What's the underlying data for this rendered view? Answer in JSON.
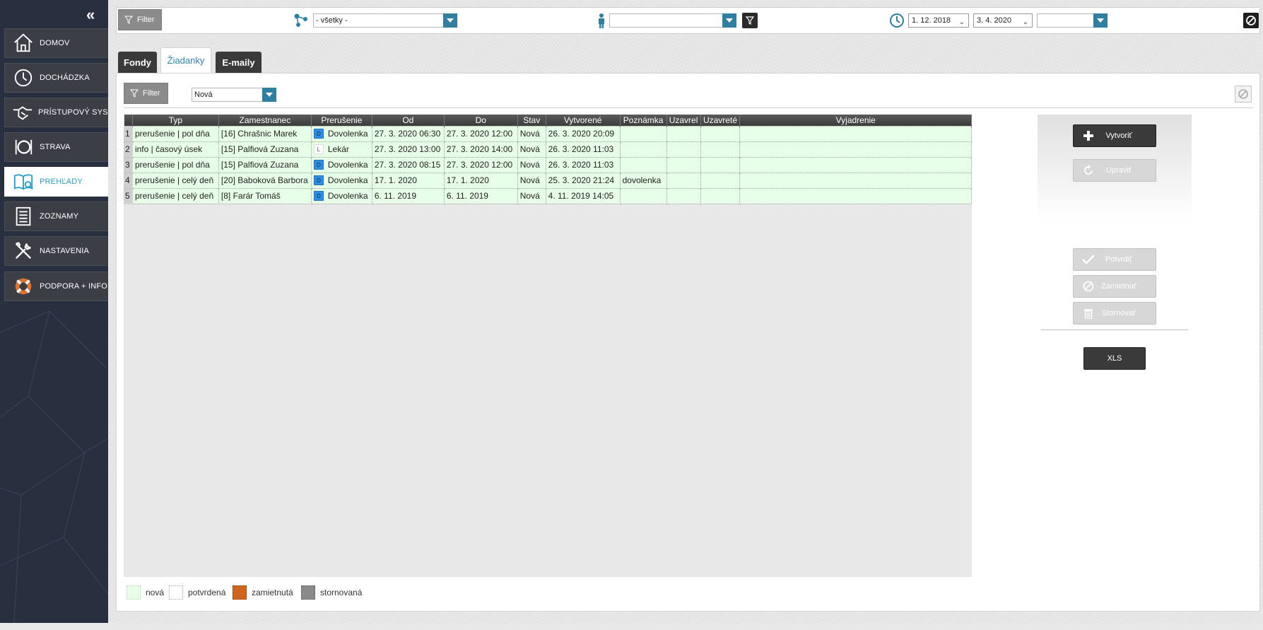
{
  "sidebar": {
    "collapse_glyph": "«",
    "items": [
      {
        "label": "DOMOV",
        "icon": "home-icon"
      },
      {
        "label": "DOCHÁDZKA",
        "icon": "clock-icon"
      },
      {
        "label": "PRÍSTUPOVÝ SYS.",
        "icon": "handshake-icon"
      },
      {
        "label": "STRAVA",
        "icon": "plate-icon"
      },
      {
        "label": "PREHĽADY",
        "icon": "book-search-icon",
        "active": true
      },
      {
        "label": "ZOZNAMY",
        "icon": "list-icon"
      },
      {
        "label": "NASTAVENIA",
        "icon": "tools-icon"
      },
      {
        "label": "PODPORA + INFO",
        "icon": "lifebuoy-icon"
      }
    ]
  },
  "topbar": {
    "filter_label": "Filter",
    "group_select": "- všetky -",
    "person_select": "",
    "date_from": "1. 12. 2018",
    "date_to": "3. 4. 2020",
    "period_select": ""
  },
  "tabs": [
    {
      "label": "Fondy"
    },
    {
      "label": "Žiadanky",
      "active": true
    },
    {
      "label": "E-maily"
    }
  ],
  "panel": {
    "filter_label": "Filter",
    "status_select": "Nová"
  },
  "grid": {
    "columns": [
      "Typ",
      "Zamestnanec",
      "Prerušenie",
      "Od",
      "Do",
      "Stav",
      "Vytvorené",
      "Poznámka",
      "Uzavrel",
      "Uzavreté",
      "Vyjadrenie"
    ],
    "rows": [
      {
        "n": "1",
        "typ": "prerušenie | pol dňa",
        "zam": "[16] Chrašnic Marek",
        "code": "D",
        "prer": "Dovolenka",
        "od": "27. 3. 2020 06:30",
        "do": "27. 3. 2020 12:00",
        "stav": "Nová",
        "vyt": "26. 3. 2020  20:09",
        "pozn": "",
        "uzavrel": "",
        "uzavrete": "",
        "vyj": ""
      },
      {
        "n": "2",
        "typ": "info | časový úsek",
        "zam": "[15] Palfiová Zuzana",
        "code": "L",
        "prer": "Lekár",
        "od": "27. 3. 2020 13:00",
        "do": "27. 3. 2020 14:00",
        "stav": "Nová",
        "vyt": "26. 3. 2020  11:03",
        "pozn": "",
        "uzavrel": "",
        "uzavrete": "",
        "vyj": ""
      },
      {
        "n": "3",
        "typ": "prerušenie | pol dňa",
        "zam": "[15] Palfiová Zuzana",
        "code": "D",
        "prer": "Dovolenka",
        "od": "27. 3. 2020 08:15",
        "do": "27. 3. 2020 12:00",
        "stav": "Nová",
        "vyt": "26. 3. 2020  11:03",
        "pozn": "",
        "uzavrel": "",
        "uzavrete": "",
        "vyj": ""
      },
      {
        "n": "4",
        "typ": "prerušenie | celý deň",
        "zam": "[20] Baboková Barbora",
        "code": "D",
        "prer": "Dovolenka",
        "od": "17. 1. 2020",
        "do": "17. 1. 2020",
        "stav": "Nová",
        "vyt": "25. 3. 2020  21:24",
        "pozn": "dovolenka",
        "uzavrel": "",
        "uzavrete": "",
        "vyj": ""
      },
      {
        "n": "5",
        "typ": "prerušenie | celý deň",
        "zam": "[8] Farár Tomáš",
        "code": "D",
        "prer": "Dovolenka",
        "od": "6. 11. 2019",
        "do": "6. 11. 2019",
        "stav": "Nová",
        "vyt": "4. 11. 2019  14:05",
        "pozn": "",
        "uzavrel": "",
        "uzavrete": "",
        "vyj": ""
      }
    ]
  },
  "actions": {
    "create": "Vytvoriť",
    "edit": "Upraviť",
    "confirm": "Potvrdiť",
    "reject": "Zamietnuť",
    "cancel": "Stornovať",
    "xls": "XLS"
  },
  "legend": [
    {
      "label": "nová",
      "color": "#e6ffe6",
      "border": "#c9e6c9"
    },
    {
      "label": "potvrdená",
      "color": "#ffffff",
      "border": "#bbbbbb"
    },
    {
      "label": "zamietnutá",
      "color": "#d0651f",
      "border": "#9a4511"
    },
    {
      "label": "stornovaná",
      "color": "#8a8a8a",
      "border": "#6a6a6a"
    }
  ],
  "colors": {
    "sidebar_bg": "#283040",
    "accent": "#2f7fa2",
    "active_tab_text": "#2f86b4",
    "row_new": "#e6ffe6",
    "code_dovolenka": "#2f8fe0"
  }
}
